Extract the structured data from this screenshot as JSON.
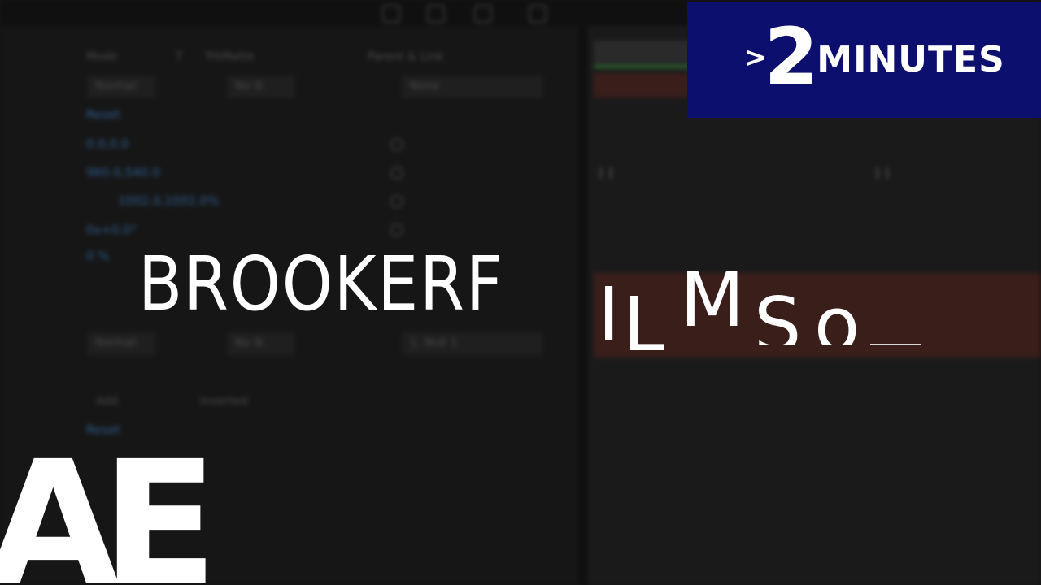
{
  "background_ui": {
    "panel_header": [
      "Mode",
      "T",
      "TrkMatte",
      "Parent & Link"
    ],
    "rows": [
      {
        "label": "Reset",
        "type": "link"
      },
      {
        "label": "0.0,0.0",
        "type": "link"
      },
      {
        "label": "960.0,540.0",
        "type": "link"
      },
      {
        "label": "1002.0,1002.0%",
        "type": "link"
      },
      {
        "label": "0x+0.0°",
        "type": "link"
      },
      {
        "label": "0 %",
        "type": "link"
      }
    ],
    "dropdowns": [
      "Normal",
      "No Ik",
      "None",
      "Normal",
      "No Ik",
      "1. Null 1"
    ],
    "footer": [
      "Add",
      "Inverted",
      "Reset"
    ]
  },
  "badge": {
    "chevron": ">",
    "number": "2",
    "word": "MINUTES"
  },
  "brand": {
    "static": "BROOKERF",
    "animated": [
      "I",
      "L",
      "M",
      "S",
      "o"
    ]
  },
  "logo": {
    "text": "AE"
  },
  "colors": {
    "badge_bg": "#0d0f6e",
    "text": "#ffffff",
    "timeline_bar": "#3a1e1a",
    "link_blue": "#2d5d8e"
  }
}
